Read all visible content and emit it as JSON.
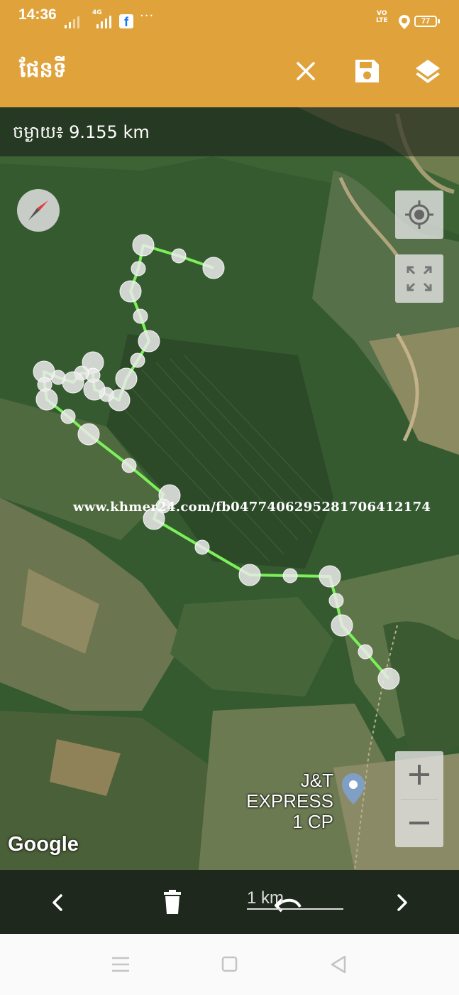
{
  "status_bar": {
    "time": "14:36",
    "network_4g": "4G",
    "facebook_badge": "f",
    "more": "···",
    "volte": "VO\nLTE",
    "battery": "77"
  },
  "app_bar": {
    "title": "ផែនទី",
    "icons": [
      "close-icon",
      "save-icon",
      "layers-icon"
    ]
  },
  "map": {
    "distance_label": "ចម្ងាយ៖ 9.155 km",
    "watermark": "www.khmer24.com/fb0477406295281706412174",
    "google_logo": "Google",
    "place_name_line1": "J&T EXPRESS",
    "place_name_line2": "1 CP",
    "track_color": "#7CF05A",
    "controls": [
      "compass-icon",
      "my-location-icon",
      "fullscreen-icon",
      "zoom-in-icon",
      "zoom-out-icon"
    ]
  },
  "toolbar": {
    "scale": "1 km",
    "icons": [
      "chevron-left-icon",
      "trash-icon",
      "undo-icon",
      "chevron-right-icon"
    ]
  },
  "nav_bar": {
    "icons": [
      "menu-icon",
      "home-icon",
      "back-icon"
    ]
  }
}
